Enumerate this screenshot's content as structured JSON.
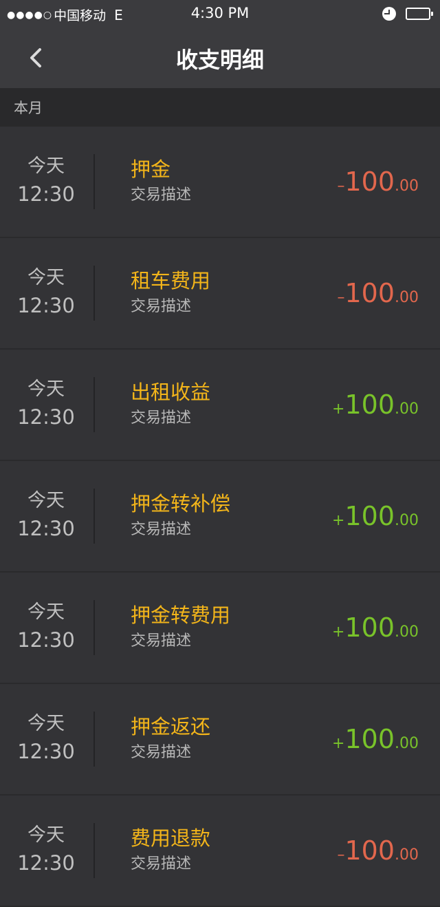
{
  "status_bar": {
    "signal": "●●●●○",
    "carrier": "中国移动",
    "network": "E",
    "time": "4:30 PM"
  },
  "nav": {
    "title": "收支明细"
  },
  "section": {
    "label": "本月"
  },
  "colors": {
    "title_yellow": "#f3b51a",
    "negative_red": "#e2674d",
    "positive_green": "#79c32a"
  },
  "transactions": [
    {
      "day": "今天",
      "time": "12:30",
      "title": "押金",
      "desc": "交易描述",
      "sign": "–",
      "amount_int": "100",
      "amount_dec": ".00",
      "type": "neg"
    },
    {
      "day": "今天",
      "time": "12:30",
      "title": "租车费用",
      "desc": "交易描述",
      "sign": "–",
      "amount_int": "100",
      "amount_dec": ".00",
      "type": "neg"
    },
    {
      "day": "今天",
      "time": "12:30",
      "title": "出租收益",
      "desc": "交易描述",
      "sign": "+",
      "amount_int": "100",
      "amount_dec": ".00",
      "type": "pos"
    },
    {
      "day": "今天",
      "time": "12:30",
      "title": "押金转补偿",
      "desc": "交易描述",
      "sign": "+",
      "amount_int": "100",
      "amount_dec": ".00",
      "type": "pos"
    },
    {
      "day": "今天",
      "time": "12:30",
      "title": "押金转费用",
      "desc": "交易描述",
      "sign": "+",
      "amount_int": "100",
      "amount_dec": ".00",
      "type": "pos"
    },
    {
      "day": "今天",
      "time": "12:30",
      "title": "押金返还",
      "desc": "交易描述",
      "sign": "+",
      "amount_int": "100",
      "amount_dec": ".00",
      "type": "pos"
    },
    {
      "day": "今天",
      "time": "12:30",
      "title": "费用退款",
      "desc": "交易描述",
      "sign": "–",
      "amount_int": "100",
      "amount_dec": ".00",
      "type": "neg"
    }
  ]
}
